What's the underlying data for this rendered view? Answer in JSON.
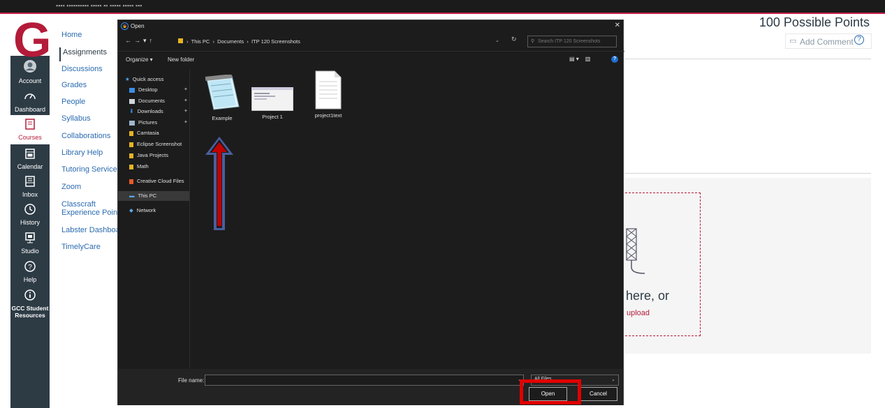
{
  "browser": {
    "topbar_text": "▪▪▪▪ ▪▪▪▪▪▪▪▪▪▪ ▪▪▪▪▪ ▪▪ ▪▪▪▪▪ ▪▪▪▪▪ ▪▪▪"
  },
  "global_nav": {
    "logo": "G",
    "items": [
      {
        "label": "Account",
        "icon": "account-icon"
      },
      {
        "label": "Dashboard",
        "icon": "dashboard-icon"
      },
      {
        "label": "Courses",
        "icon": "courses-icon"
      },
      {
        "label": "Calendar",
        "icon": "calendar-icon"
      },
      {
        "label": "Inbox",
        "icon": "inbox-icon"
      },
      {
        "label": "History",
        "icon": "history-icon"
      },
      {
        "label": "Studio",
        "icon": "studio-icon"
      },
      {
        "label": "Help",
        "icon": "help-icon"
      },
      {
        "label": "GCC Student",
        "label2": "Resources",
        "icon": "info-icon"
      }
    ]
  },
  "course_nav": {
    "items": [
      "Home",
      "Assignments",
      "Discussions",
      "Grades",
      "People",
      "Syllabus",
      "Collaborations",
      "Library Help",
      "Tutoring Services",
      "Zoom",
      "Classcraft",
      "Experience Points",
      "Labster Dashboard",
      "TimelyCare"
    ]
  },
  "assignment": {
    "points": "100 Possible Points",
    "add_comment": "Add Comment",
    "drop_text": "here, or",
    "upload_text": "upload"
  },
  "dialog": {
    "title": "Open",
    "close": "✕",
    "path": [
      "This PC",
      "Documents",
      "ITP 120 Screenshots"
    ],
    "search_placeholder": "Search ITP 120 Screenshots",
    "organize": "Organize ▾",
    "new_folder": "New folder",
    "sidebar": [
      {
        "label": "Quick access",
        "color": "#4aa3f0"
      },
      {
        "label": "Desktop",
        "color": "#3a8ee6",
        "pinned": true
      },
      {
        "label": "Documents",
        "color": "#cfd6dd",
        "pinned": true
      },
      {
        "label": "Downloads",
        "color": "#3a8ee6",
        "pinned": true
      },
      {
        "label": "Pictures",
        "color": "#9fb7cf",
        "pinned": true
      },
      {
        "label": "Camtasia",
        "color": "#e6b422"
      },
      {
        "label": "Eclipse Screenshot",
        "color": "#e6b422"
      },
      {
        "label": "Java Projects",
        "color": "#e6b422"
      },
      {
        "label": "Math",
        "color": "#e6b422"
      },
      {
        "label": "Creative Cloud Files",
        "color": "#e85a2a"
      },
      {
        "label": "This PC",
        "color": "#5aa7e6",
        "selected": true
      },
      {
        "label": "Network",
        "color": "#5aa7e6"
      }
    ],
    "files": [
      {
        "name": "Example",
        "icon": "notepad-icon"
      },
      {
        "name": "Project 1",
        "icon": "screenshot-thumbnail-icon"
      },
      {
        "name": "project1text",
        "icon": "text-file-icon"
      }
    ],
    "file_name_label": "File name:",
    "file_name_value": "",
    "file_type": "All Files",
    "open_label": "Open",
    "cancel_label": "Cancel"
  },
  "annotations": {
    "arrow_color": "#c00000",
    "arrow_outline": "#4a5fa0",
    "highlight_color": "#e00000"
  }
}
